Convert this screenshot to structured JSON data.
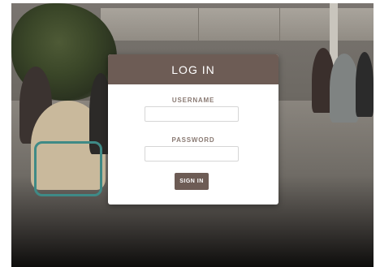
{
  "login": {
    "title": "LOG IN",
    "username_label": "USERNAME",
    "username_value": "",
    "password_label": "PASSWORD",
    "password_value": "",
    "submit_label": "SIGN IN"
  },
  "colors": {
    "header_bg": "#6d5c55",
    "button_bg": "#6d5c55",
    "label_text": "#8a7a73",
    "modal_bg": "#ffffff"
  }
}
